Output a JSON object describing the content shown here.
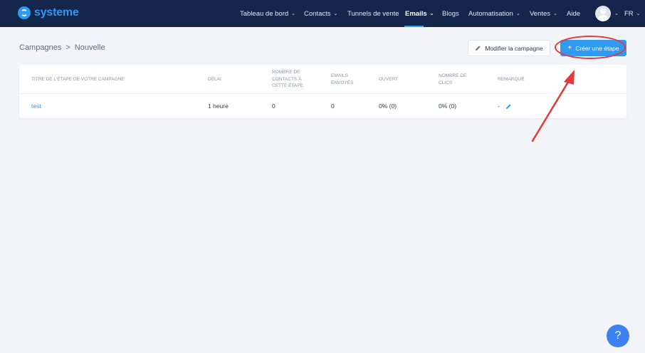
{
  "header": {
    "logo_text": "systeme",
    "nav": [
      {
        "label": "Tableau de bord",
        "chevron": true
      },
      {
        "label": "Contacts",
        "chevron": true
      },
      {
        "label": "Tunnels de vente",
        "chevron": false
      },
      {
        "label": "Emails",
        "chevron": true,
        "active": true
      },
      {
        "label": "Blogs",
        "chevron": false
      },
      {
        "label": "Automatisation",
        "chevron": true
      },
      {
        "label": "Ventes",
        "chevron": true
      },
      {
        "label": "Aide",
        "chevron": false
      }
    ],
    "language": "FR",
    "chevron_glyph": "⌄"
  },
  "breadcrumb": {
    "parent": "Campagnes",
    "separator": ">",
    "current": "Nouvelle"
  },
  "actions": {
    "modify_label": "Modifier la campagne",
    "modify_icon": "pencil-icon",
    "create_label": "Créer une étape",
    "create_icon": "plus-icon"
  },
  "table": {
    "columns": [
      "Titre de l'étape de votre campagne",
      "Délai",
      "Nombre de contacts à cette étape",
      "Emails envoyés",
      "Ouvert",
      "Nombre de clics",
      "Remarque"
    ],
    "rows": [
      {
        "title": "test",
        "delay": "1 heure",
        "contacts": "0",
        "sent": "0",
        "opened": "0% (0)",
        "clicks": "0% (0)",
        "remark": "-"
      }
    ]
  },
  "help": {
    "label": "?"
  },
  "colors": {
    "topbar": "#14264b",
    "accent": "#2e9af2",
    "annotation": "#e23a3a",
    "background": "#f2f4f8"
  }
}
